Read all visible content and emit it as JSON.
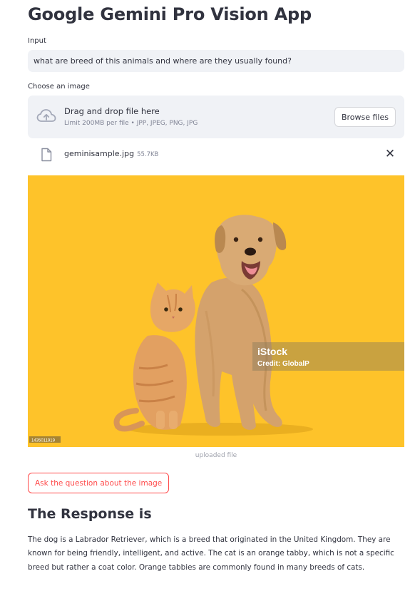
{
  "app": {
    "title": "Google Gemini Pro Vision App"
  },
  "input": {
    "label": "Input",
    "value": "what are breed of this animals and where are they usually found?"
  },
  "uploader": {
    "label": "Choose an image",
    "drop_title": "Drag and drop file here",
    "drop_limits": "Limit 200MB per file • JPP, JPEG, PNG, JPG",
    "browse_label": "Browse files",
    "icon": "cloud-upload-icon"
  },
  "file": {
    "name": "geminisample.jpg",
    "size": "55.7KB",
    "icon": "file-icon",
    "close_glyph": "✕"
  },
  "image": {
    "watermark_brand": "iStock",
    "watermark_credit": "Credit: GlobalP",
    "stock_id": "1435011919",
    "caption": "uploaded file",
    "background_color": "#fec32a"
  },
  "actions": {
    "ask_label": "Ask the question about the image"
  },
  "response": {
    "title": "The Response is",
    "text": "The dog is a Labrador Retriever, which is a breed that originated in the United Kingdom. They are known for being friendly, intelligent, and active. The cat is an orange tabby, which is not a specific breed but rather a coat color. Orange tabbies are commonly found in many breeds of cats."
  },
  "colors": {
    "accent": "#ff4b4b",
    "text": "#31333f",
    "muted": "#808495",
    "field_bg": "#f0f2f6"
  }
}
